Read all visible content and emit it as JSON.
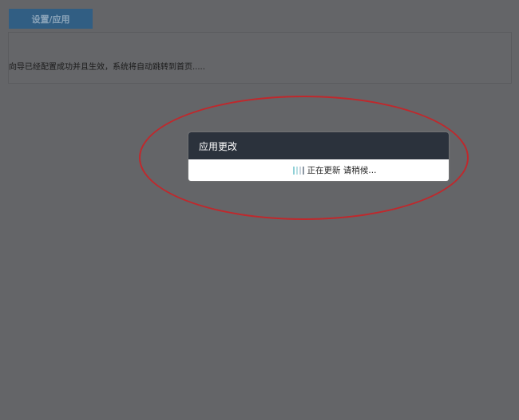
{
  "tab": {
    "label": "设置/应用"
  },
  "panel": {
    "message": "向导已经配置成功并且生效，系统将自动跳转到首页....."
  },
  "dialog": {
    "title": "应用更改",
    "status": "正在更新 请稍候..."
  },
  "colors": {
    "accent": "#315e83",
    "highlight": "#c0282c",
    "dialog_header": "#2b323c"
  }
}
